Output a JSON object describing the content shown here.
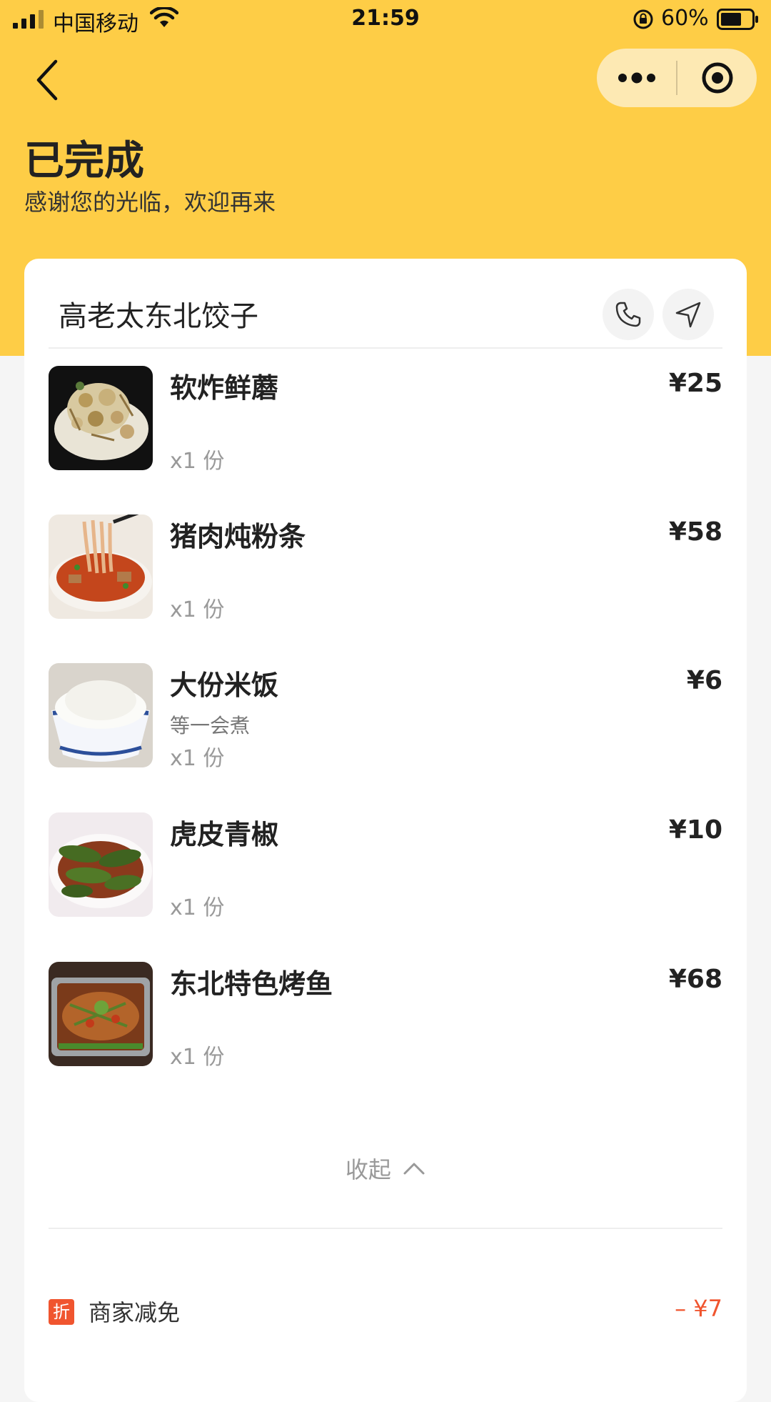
{
  "status_bar": {
    "carrier": "中国移动",
    "time": "21:59",
    "battery": "60%"
  },
  "header": {
    "title": "已完成",
    "subtitle": "感谢您的光临，欢迎再来"
  },
  "shop": {
    "name": "高老太东北饺子"
  },
  "items": [
    {
      "name": "软炸鲜蘑",
      "price": "¥25",
      "qty": "x1 份",
      "note": "",
      "thumb_caption": "软炸鲜蘑"
    },
    {
      "name": "猪肉炖粉条",
      "price": "¥58",
      "qty": "x1 份",
      "note": "",
      "thumb_caption": "猪肉炖粉条"
    },
    {
      "name": "大份米饭",
      "price": "¥6",
      "qty": "x1 份",
      "note": "等一会煮",
      "thumb_caption": ""
    },
    {
      "name": "虎皮青椒",
      "price": "¥10",
      "qty": "x1 份",
      "note": "",
      "thumb_caption": ""
    },
    {
      "name": "东北特色烤鱼",
      "price": "¥68",
      "qty": "x1 份",
      "note": "",
      "thumb_caption": ""
    }
  ],
  "collapse_label": "收起",
  "discount": {
    "badge": "折",
    "label": "商家减免",
    "amount": "– ¥7"
  },
  "colors": {
    "brand_yellow": "#fecd46",
    "discount_red": "#f0552f"
  },
  "icons": [
    "signal-icon",
    "wifi-icon",
    "rotation-lock-icon",
    "battery-icon",
    "back-arrow-icon",
    "more-dots-icon",
    "close-target-icon",
    "phone-icon",
    "navigate-icon",
    "chevron-up-icon"
  ]
}
